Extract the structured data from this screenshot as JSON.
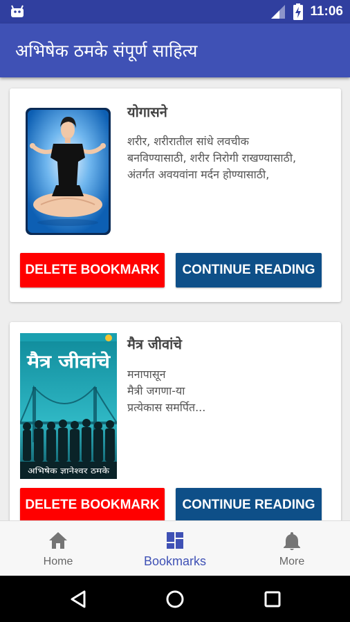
{
  "status_bar": {
    "time": "11:06",
    "icons": [
      "android-notification-icon",
      "signal-icon",
      "battery-charging-icon"
    ]
  },
  "app_bar": {
    "title": "अभिषेक ठमके संपूर्ण साहित्य"
  },
  "bookmarks": [
    {
      "title": "योगासने",
      "description": "शरीर, शरीरातील सांधे लवचीक\nबनविण्यासाठी, शरीर निरोगी राखण्यासाठी,\nअंतर्गत अवयवांना मर्दन होण्यासाठी,",
      "delete_label": "DELETE BOOKMARK",
      "continue_label": "CONTINUE READING"
    },
    {
      "title": "मैत्र जीवांचे",
      "description": "मनापासून\nमैत्री जगणा-या\nप्रत्येकास समर्पित...",
      "delete_label": "DELETE BOOKMARK",
      "continue_label": "CONTINUE READING",
      "cover": {
        "title": "मैत्र जीवांचे",
        "author": "अभिषेक ज्ञानेश्वर ठमके"
      }
    }
  ],
  "bottom_nav": {
    "items": [
      {
        "label": "Home",
        "icon": "home-icon"
      },
      {
        "label": "Bookmarks",
        "icon": "bookmarks-dashboard-icon",
        "active": true
      },
      {
        "label": "More",
        "icon": "bell-icon"
      }
    ]
  },
  "colors": {
    "status_bar": "#303f9f",
    "app_bar": "#3f51b5",
    "delete_button": "#ff0000",
    "continue_button": "#0e4f88",
    "active_nav": "#3f51b5"
  }
}
